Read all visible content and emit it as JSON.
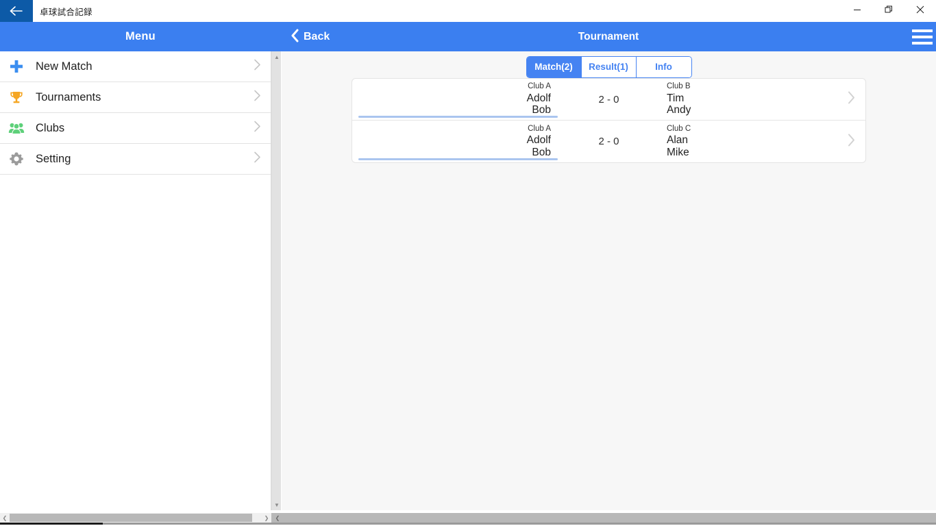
{
  "window": {
    "title": "卓球試合記録",
    "back_icon": "arrow-left-icon",
    "controls": {
      "minimize": "minimize-icon",
      "maximize": "restore-icon",
      "close": "close-icon"
    }
  },
  "sidebar": {
    "header_title": "Menu",
    "items": [
      {
        "label": "New Match",
        "icon": "plus-icon",
        "color": "#3b8ef0"
      },
      {
        "label": "Tournaments",
        "icon": "trophy-icon",
        "color": "#f5a623"
      },
      {
        "label": "Clubs",
        "icon": "people-icon",
        "color": "#5ed07a"
      },
      {
        "label": "Setting",
        "icon": "gear-icon",
        "color": "#9b9b9b"
      }
    ],
    "chevron_icon": "chevron-right-icon"
  },
  "content_header": {
    "back_label": "Back",
    "back_icon": "chevron-left-icon",
    "title": "Tournament",
    "menu_icon": "hamburger-icon"
  },
  "tabs": [
    {
      "label": "Match(2)",
      "active": true
    },
    {
      "label": "Result(1)",
      "active": false
    },
    {
      "label": "Info",
      "active": false
    }
  ],
  "matches": [
    {
      "left": {
        "club": "Club A",
        "players": [
          "Adolf",
          "Bob"
        ],
        "winner": true
      },
      "score": "2 - 0",
      "right": {
        "club": "Club B",
        "players": [
          "Tim",
          "Andy"
        ],
        "winner": false
      },
      "chevron_icon": "chevron-right-icon"
    },
    {
      "left": {
        "club": "Club A",
        "players": [
          "Adolf",
          "Bob"
        ],
        "winner": true
      },
      "score": "2 - 0",
      "right": {
        "club": "Club C",
        "players": [
          "Alan",
          "Mike"
        ],
        "winner": false
      },
      "chevron_icon": "chevron-right-icon"
    }
  ],
  "scrollbars": {
    "sidebar_vertical_up": "▲",
    "sidebar_vertical_down": "▼",
    "left_h_arrow": "❮",
    "right_h_arrow": "❯",
    "right_panel_arrow": "❮"
  },
  "colors": {
    "accent": "#3b7ff0",
    "tab_accent": "#4583f2",
    "titlebar_back": "#0d5aa7",
    "winner_underline": "#aac5ef",
    "content_bg": "#f7f7f7"
  }
}
